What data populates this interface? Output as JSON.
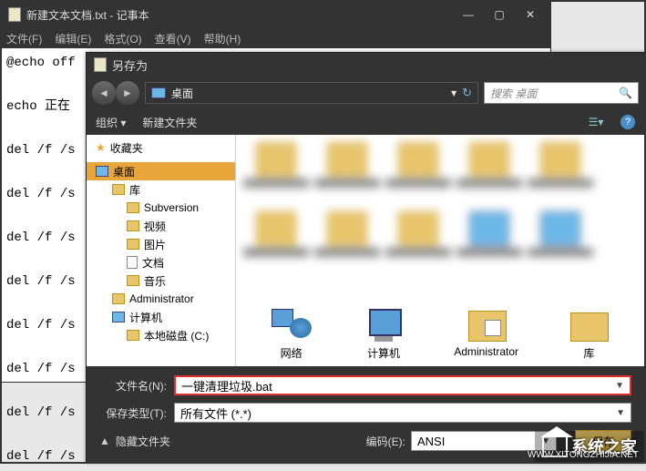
{
  "notepad": {
    "title": "新建文本文档.txt - 记事本",
    "menus": {
      "file": "文件(F)",
      "edit": "编辑(E)",
      "format": "格式(O)",
      "view": "查看(V)",
      "help": "帮助(H)"
    },
    "content": "@echo off\n\necho 正在\n\ndel /f /s\n\ndel /f /s\n\ndel /f /s\n\ndel /f /s\n\ndel /f /s\n\ndel /f /s\n\ndel /f /s\n\ndel /f /s"
  },
  "saveas": {
    "title": "另存为",
    "path_label": "桌面",
    "search_placeholder": "搜索 桌面",
    "toolbar": {
      "organize": "组织 ▾",
      "newfolder": "新建文件夹"
    },
    "sidebar": {
      "favorites": "收藏夹",
      "desktop": "桌面",
      "libraries": "库",
      "subversion": "Subversion",
      "videos": "视频",
      "pictures": "图片",
      "documents": "文档",
      "music": "音乐",
      "administrator": "Administrator",
      "computer": "计算机",
      "localdisk": "本地磁盘 (C:)"
    },
    "bigicons": {
      "network": "网络",
      "computer": "计算机",
      "administrator": "Administrator",
      "libraries": "库"
    },
    "filename_label": "文件名(N):",
    "filename_value": "一键清理垃圾.bat",
    "filetype_label": "保存类型(T):",
    "filetype_value": "所有文件 (*.*)",
    "hide_folders": "隐藏文件夹",
    "encoding_label": "编码(E):",
    "encoding_value": "ANSI",
    "save_btn": "保存",
    "cancel_btn": "取消"
  },
  "watermark": {
    "text": "系统之家",
    "url": "WWW.XITONGZHIJIA.NET"
  }
}
